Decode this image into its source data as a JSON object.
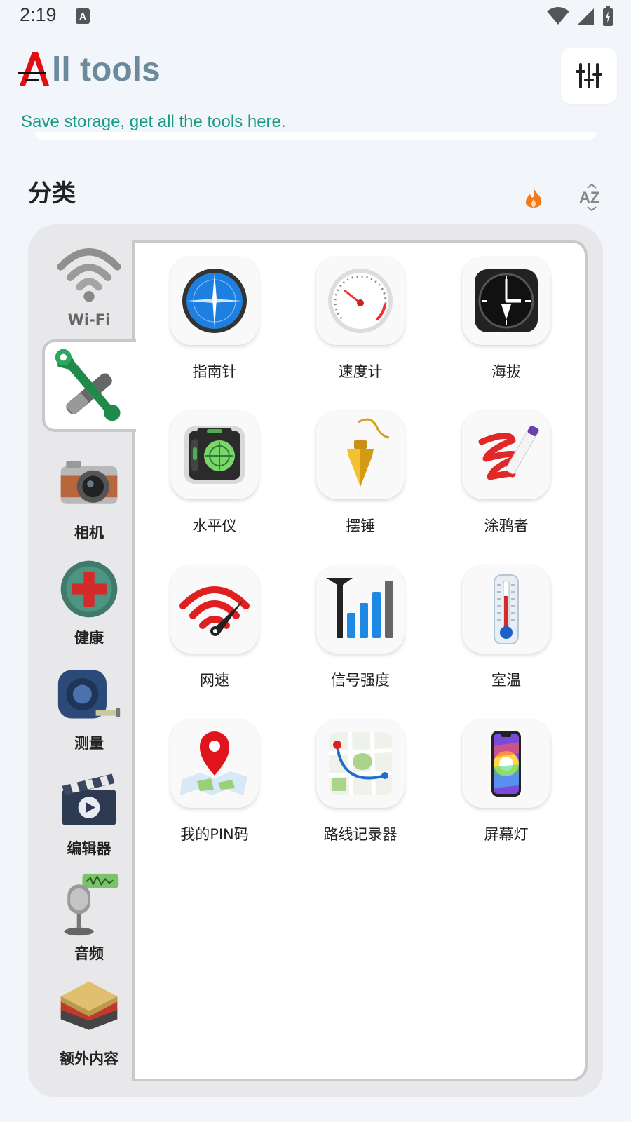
{
  "status": {
    "time": "2:19",
    "notif_icon": "A"
  },
  "header": {
    "title_rest": "ll tools",
    "tagline": "Save storage, get all the tools here."
  },
  "category": {
    "title": "分类"
  },
  "sidebar": {
    "items": [
      {
        "label": "Wi-Fi",
        "icon": "wifi-icon"
      },
      {
        "label": "",
        "icon": "tools-icon",
        "selected": true
      },
      {
        "label": "相机",
        "icon": "camera-icon"
      },
      {
        "label": "健康",
        "icon": "health-icon"
      },
      {
        "label": "测量",
        "icon": "tape-measure-icon"
      },
      {
        "label": "编辑器",
        "icon": "video-editor-icon"
      },
      {
        "label": "音频",
        "icon": "microphone-icon"
      },
      {
        "label": "额外内容",
        "icon": "layers-icon"
      }
    ]
  },
  "tools": [
    {
      "label": "指南针",
      "icon": "compass-icon"
    },
    {
      "label": "速度计",
      "icon": "speedometer-icon"
    },
    {
      "label": "海拔",
      "icon": "altimeter-icon"
    },
    {
      "label": "水平仪",
      "icon": "level-icon"
    },
    {
      "label": "摆锤",
      "icon": "plumb-bob-icon"
    },
    {
      "label": "涂鸦者",
      "icon": "scribble-icon"
    },
    {
      "label": "网速",
      "icon": "network-speed-icon"
    },
    {
      "label": "信号强度",
      "icon": "signal-strength-icon"
    },
    {
      "label": "室温",
      "icon": "thermometer-icon"
    },
    {
      "label": "我的PIN码",
      "icon": "map-pin-icon"
    },
    {
      "label": "路线记录器",
      "icon": "route-map-icon"
    },
    {
      "label": "屏幕灯",
      "icon": "screen-light-icon"
    }
  ],
  "colors": {
    "accent": "#1a9a85",
    "title": "#6b8a9c",
    "logo_red": "#e01010",
    "hot": "#f07a1c"
  }
}
